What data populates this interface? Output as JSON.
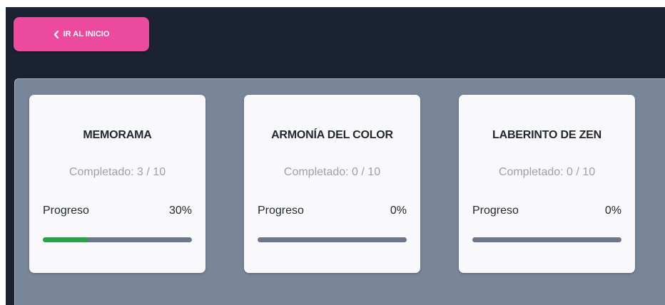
{
  "header": {
    "back_label": "IR AL INICIO"
  },
  "colors": {
    "background": "#1b2333",
    "accent_pink": "#ec4a9e",
    "panel": "#798599",
    "progress_fill": "#27a24b",
    "progress_track": "#6c7789"
  },
  "icons": {
    "back": "chevron-left-icon"
  },
  "games": [
    {
      "title": "MEMORAMA",
      "completed": "Completado: 3 / 10",
      "progress_label": "Progreso",
      "progress_text": "30%",
      "progress": 0.3
    },
    {
      "title": "ARMONÍA DEL COLOR",
      "completed": "Completado: 0 / 10",
      "progress_label": "Progreso",
      "progress_text": "0%",
      "progress": 0
    },
    {
      "title": "LABERINTO DE ZEN",
      "completed": "Completado: 0 / 10",
      "progress_label": "Progreso",
      "progress_text": "0%",
      "progress": 0
    }
  ]
}
